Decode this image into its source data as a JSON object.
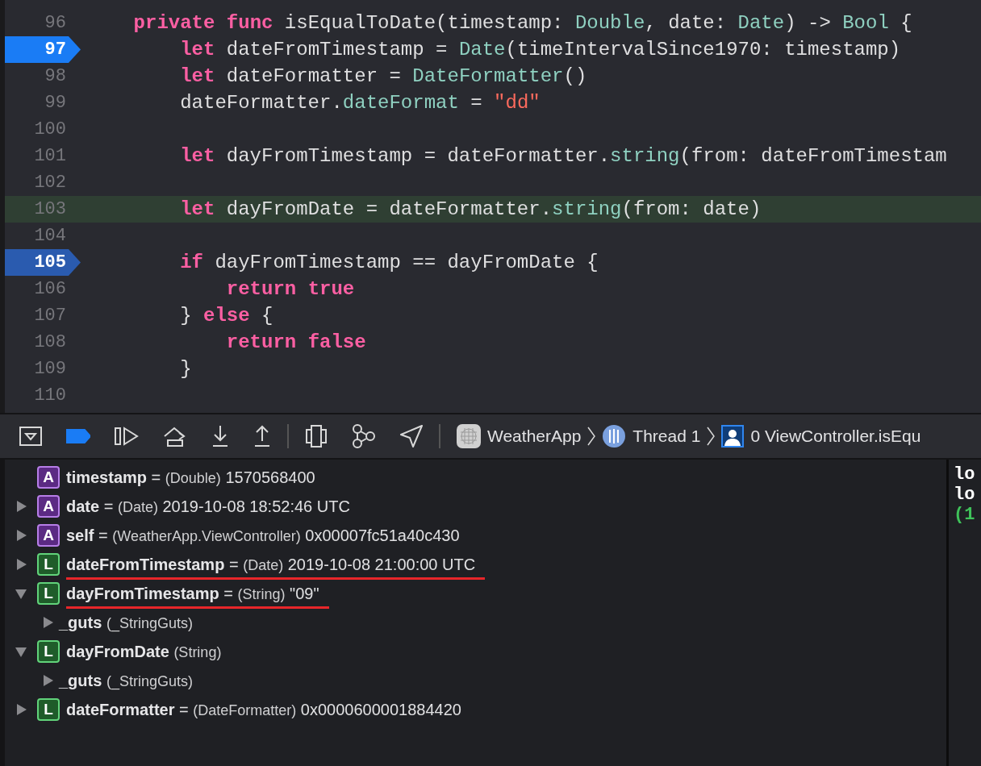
{
  "editor": {
    "lines": [
      {
        "number": "96",
        "tokens": [
          {
            "t": "private",
            "kind": "keyword"
          },
          {
            "t": "func",
            "kind": "keyword"
          },
          {
            "t": "isEqualToDate(timestamp:"
          },
          {
            "t": "Double",
            "kind": "type"
          },
          {
            "t": ", date:",
            "kind": "punct"
          },
          {
            "t": "Date",
            "kind": "type"
          },
          {
            "t": ") ->",
            "kind": "punct"
          },
          {
            "t": "Bool",
            "kind": "type"
          },
          {
            "t": "{"
          }
        ],
        "children": [
          {
            "number": "97",
            "breakpoint": true,
            "breakpoint_dimmed": false,
            "tokens": [
              {
                "t": "let",
                "kind": "keyword"
              },
              {
                "t": "dateFromTimestamp ="
              },
              {
                "t": "Date",
                "kind": "type"
              },
              {
                "t": "(timeIntervalSince1970: timestamp)",
                "kind": "punct"
              }
            ]
          },
          {
            "number": "98",
            "tokens": [
              {
                "t": "let",
                "kind": "keyword"
              },
              {
                "t": "dateFormatter ="
              },
              {
                "t": "DateFormatter",
                "kind": "type"
              },
              {
                "t": "()",
                "kind": "punct"
              }
            ]
          },
          {
            "number": "99",
            "tokens": [
              {
                "t": "dateFormatter.",
                "kind": "punct"
              },
              {
                "t": "dateFormat",
                "kind": "type"
              },
              {
                "t": "="
              },
              {
                "t": "\"dd\"",
                "kind": "string"
              }
            ]
          },
          {
            "number": "100"
          },
          {
            "number": "101",
            "tokens": [
              {
                "t": "let",
                "kind": "keyword"
              },
              {
                "t": "dayFromTimestamp = dateFormatter.",
                "kind": "punct"
              },
              {
                "t": "string",
                "kind": "type"
              },
              {
                "t": "(from: dateFromTimestam",
                "kind": "punct"
              }
            ]
          },
          {
            "number": "102"
          },
          {
            "number": "103",
            "highlighted": true,
            "tokens": [
              {
                "t": "let",
                "kind": "keyword"
              },
              {
                "t": "dayFromDate = dateFormatter.",
                "kind": "punct"
              },
              {
                "t": "string",
                "kind": "type"
              },
              {
                "t": "(from: date)",
                "kind": "punct"
              }
            ]
          },
          {
            "number": "104"
          },
          {
            "number": "105",
            "breakpoint": true,
            "breakpoint_dimmed": true,
            "tokens": [
              {
                "t": "if",
                "kind": "keyword"
              },
              {
                "t": "dayFromTimestamp == dayFromDate {"
              }
            ],
            "children": [
              {
                "number": "106",
                "tokens": [
                  {
                    "t": "return",
                    "kind": "keyword"
                  },
                  {
                    "t": "true",
                    "kind": "keyword"
                  }
                ]
              }
            ]
          },
          {
            "number": "107",
            "tokens": [
              {
                "t": "}"
              },
              {
                "t": "else",
                "kind": "keyword"
              },
              {
                "t": "{"
              }
            ],
            "children": [
              {
                "number": "108",
                "tokens": [
                  {
                    "t": "return",
                    "kind": "keyword"
                  },
                  {
                    "t": "false",
                    "kind": "keyword"
                  }
                ]
              }
            ]
          },
          {
            "number": "109",
            "tokens": [
              {
                "t": "}"
              }
            ]
          }
        ]
      },
      {
        "number": "110"
      }
    ]
  },
  "debug_bar": {
    "breakpoints_active": true,
    "breadcrumb": [
      {
        "label": "WeatherApp",
        "kind": "app"
      },
      {
        "label": "Thread 1",
        "kind": "thread"
      },
      {
        "label": "0 ViewController.isEqu",
        "kind": "frame"
      }
    ]
  },
  "variables": [
    {
      "badge": "A",
      "kind": "argument",
      "name": "timestamp",
      "equals": "=",
      "type": "(Double)",
      "value": "1570568400"
    },
    {
      "badge": "A",
      "kind": "argument",
      "name": "date",
      "equals": "=",
      "type": "(Date)",
      "value": "2019-10-08 18:52:46 UTC",
      "expanded": false
    },
    {
      "badge": "A",
      "kind": "argument",
      "name": "self",
      "equals": "=",
      "type": "(WeatherApp.ViewController)",
      "value": "0x00007fc51a40c430",
      "expanded": false
    },
    {
      "badge": "L",
      "kind": "local",
      "name": "dateFromTimestamp",
      "equals": "=",
      "type": "(Date)",
      "value": "2019-10-08 21:00:00 UTC",
      "expanded": false,
      "underlined": true
    },
    {
      "badge": "L",
      "kind": "local",
      "name": "dayFromTimestamp",
      "equals": "=",
      "type": "(String)",
      "value": "\"09\"",
      "expanded": true,
      "underlined": true,
      "children": [
        {
          "name": "_guts",
          "type": "(_StringGuts)",
          "expanded": false
        }
      ]
    },
    {
      "badge": "L",
      "kind": "local",
      "name": "dayFromDate",
      "type": "(String)",
      "expanded": true,
      "children": [
        {
          "name": "_guts",
          "type": "(_StringGuts)",
          "expanded": false
        }
      ]
    },
    {
      "badge": "L",
      "kind": "local",
      "name": "dateFormatter",
      "equals": "=",
      "type": "(DateFormatter)",
      "value": "0x0000600001884420",
      "expanded": false
    }
  ],
  "console": [
    {
      "text": "lo",
      "kind": "plain"
    },
    {
      "text": "lo",
      "kind": "plain"
    },
    {
      "text": "(1",
      "kind": "result"
    }
  ]
}
